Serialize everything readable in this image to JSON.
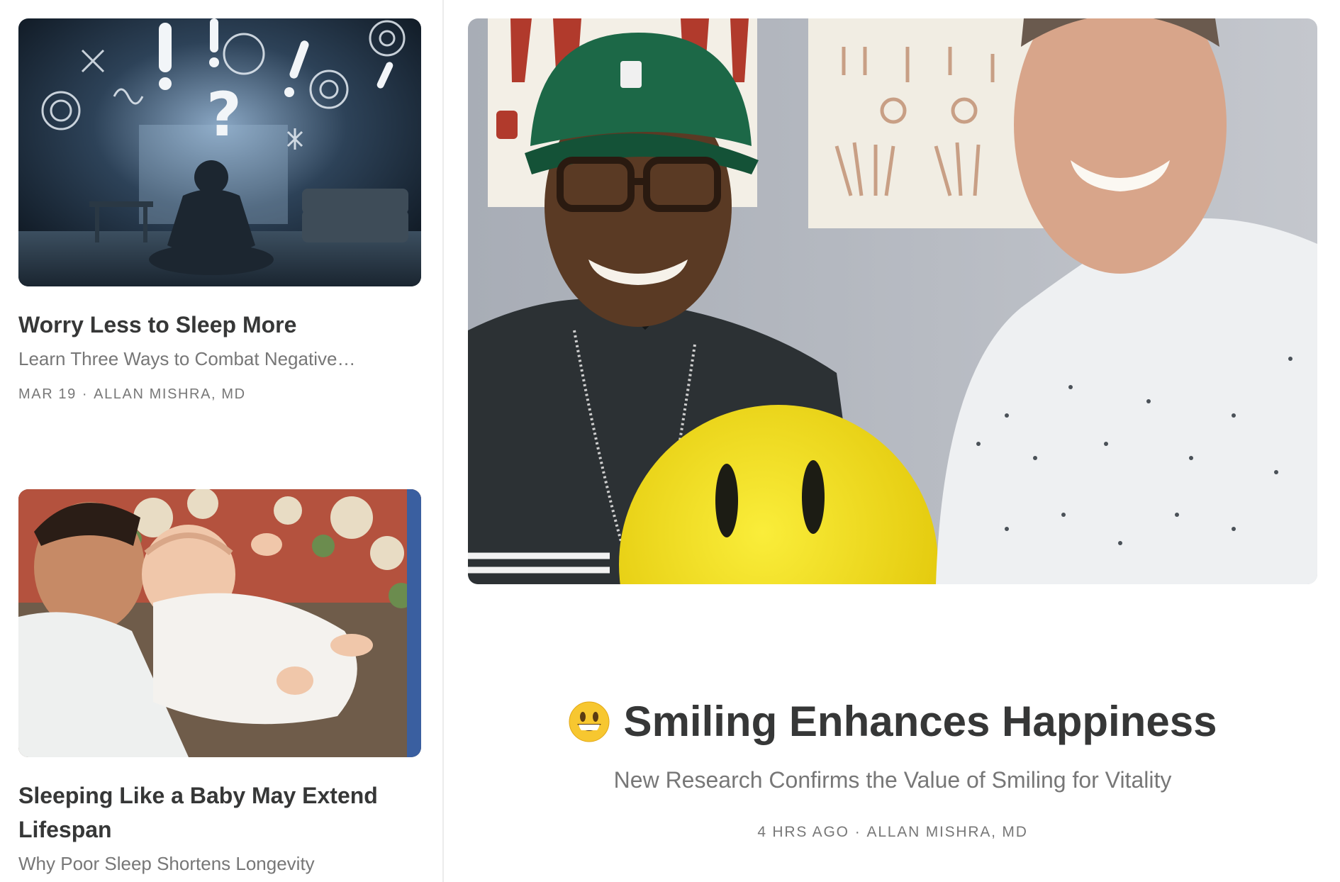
{
  "posts": [
    {
      "title": "Worry Less to Sleep More",
      "subtitle": "Learn Three Ways to Combat Negative…",
      "date": "MAR 19",
      "author": "ALLAN MISHRA, MD",
      "image_subject": "anxious-man-meditating-illustration"
    },
    {
      "title": "Sleeping Like a Baby May Extend Lifespan",
      "subtitle": "Why Poor Sleep Shortens Longevity",
      "image_subject": "father-sleeping-with-baby-photo"
    }
  ],
  "hero": {
    "emoji": "grinning-face-emoji",
    "title": "Smiling Enhances Happiness",
    "subtitle": "New Research Confirms the Value of Smiling for Vitality",
    "date": "4 HRS AGO",
    "author": "ALLAN MISHRA, MD",
    "image_subject": "two-men-with-yellow-smiley-face-photo"
  },
  "meta_separator": "·",
  "colors": {
    "text_primary": "#363737",
    "text_secondary": "#777777",
    "divider": "#ececec",
    "smiley_yellow": "#f2e21a"
  }
}
